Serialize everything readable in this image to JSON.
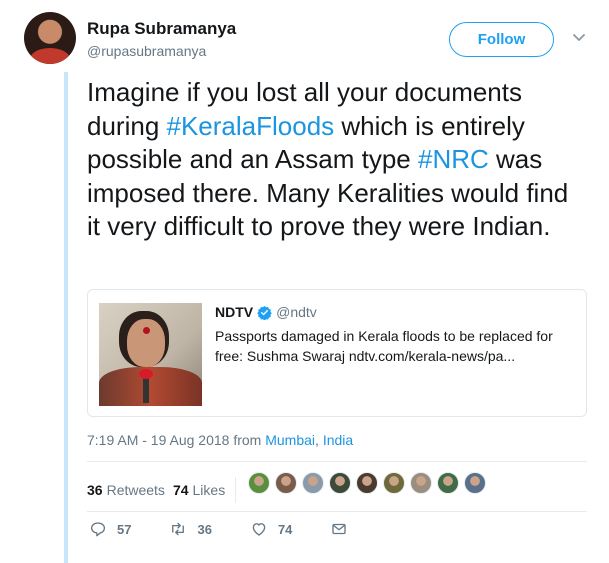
{
  "author": {
    "name": "Rupa Subramanya",
    "handle": "@rupasubramanya",
    "avatar_icon": "profile-photo"
  },
  "follow_button": {
    "label": "Follow"
  },
  "tweet": {
    "segments": [
      {
        "text": "Imagine if you lost all your documents during ",
        "type": "text"
      },
      {
        "text": "#KeralaFloods",
        "type": "hashtag"
      },
      {
        "text": " which is entirely possible and an Assam type ",
        "type": "text"
      },
      {
        "text": "#NRC",
        "type": "hashtag"
      },
      {
        "text": " was imposed there. Many Keralities would find it very difficult to prove they were Indian.",
        "type": "text"
      }
    ]
  },
  "quoted": {
    "author": "NDTV",
    "verified": true,
    "handle": "@ndtv",
    "text": "Passports damaged in Kerala floods to be replaced for free: Sushma Swaraj ndtv.com/kerala-news/pa..."
  },
  "timestamp": {
    "time": "7:19 AM - 19 Aug 2018 from ",
    "location_city": "Mumbai",
    "location_sep": ", ",
    "location_country": "India"
  },
  "stats": {
    "retweets_count": "36",
    "retweets_label": "Retweets",
    "likes_count": "74",
    "likes_label": "Likes"
  },
  "likers_colors": [
    "#5a8f3d",
    "#7a5c4a",
    "#8a9aa8",
    "#3d4a3a",
    "#4b3a2e",
    "#6e6a3a",
    "#9a8e80",
    "#3f6b46",
    "#5b6f8a"
  ],
  "actions": {
    "reply_count": "57",
    "retweet_count": "36",
    "like_count": "74"
  },
  "colors": {
    "accent": "#1da1f2",
    "hashtag": "#1b95e0",
    "secondary_text": "#657786",
    "thread_line": "#c8e6f9"
  }
}
